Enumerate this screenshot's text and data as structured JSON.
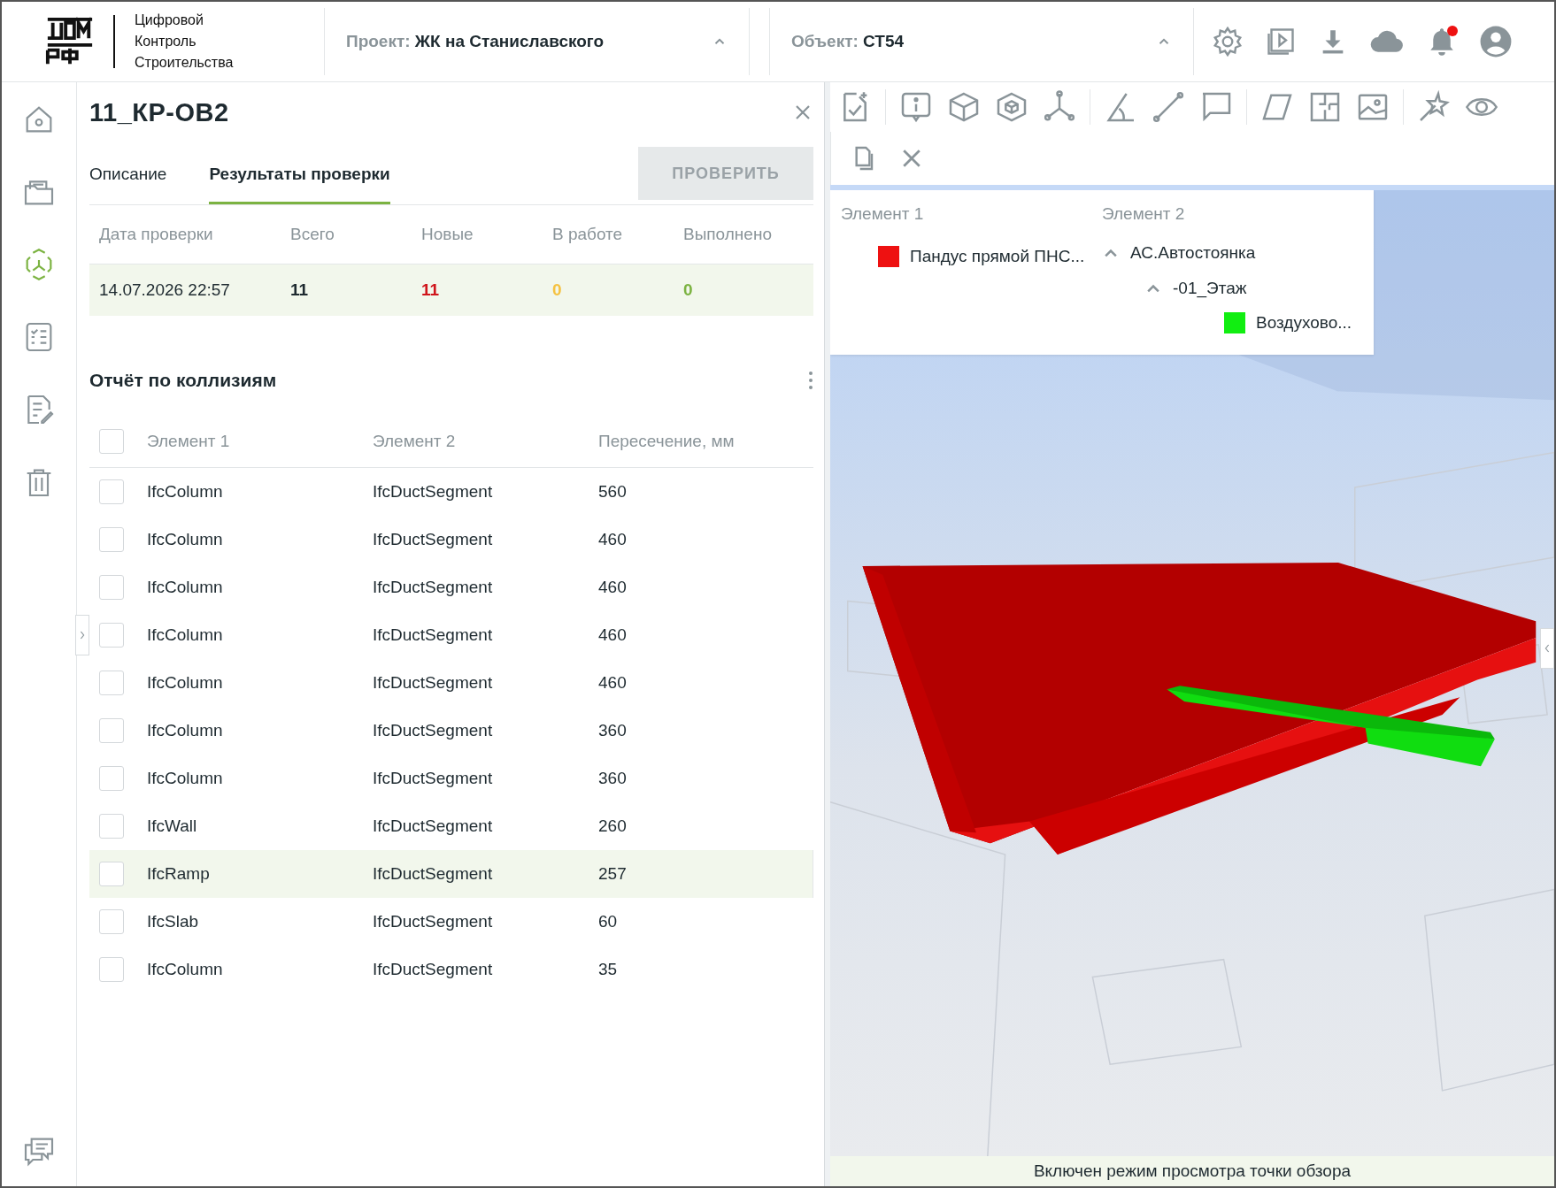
{
  "header": {
    "logo_lines": [
      "Цифровой",
      "Контроль",
      "Строительства"
    ],
    "project": {
      "label": "Проект:",
      "value": "ЖК на Станиславского",
      "expanded": true
    },
    "object": {
      "label": "Объект:",
      "value": "СТ54",
      "expanded": true
    },
    "notifications": {
      "unread": true
    }
  },
  "sidebar": {
    "items": [
      {
        "kind": "home",
        "selected": false
      },
      {
        "kind": "folder",
        "selected": false
      },
      {
        "kind": "model",
        "selected": true
      },
      {
        "kind": "checklist",
        "selected": false
      },
      {
        "kind": "document",
        "selected": false
      },
      {
        "kind": "trash",
        "selected": false
      }
    ]
  },
  "panel": {
    "title": "11_КР-ОВ2",
    "tabs": [
      {
        "label": "Описание",
        "selected": false
      },
      {
        "label": "Результаты проверки",
        "selected": true
      }
    ],
    "check_button": {
      "label": "ПРОВЕРИТЬ",
      "disabled": true
    },
    "summary": {
      "columns": [
        "Дата проверки",
        "Всего",
        "Новые",
        "В работе",
        "Выполнено"
      ],
      "cells": [
        {
          "text": "14.07.2026 22:57",
          "color": "#1e2a30"
        },
        {
          "text": "11",
          "color": "#1e2a30"
        },
        {
          "text": "11",
          "color": "#d0151b"
        },
        {
          "text": "0",
          "color": "#f5c242"
        },
        {
          "text": "0",
          "color": "#7cb342"
        }
      ]
    },
    "report": {
      "title": "Отчёт по коллизиям",
      "select_all": false,
      "columns": [
        "Элемент 1",
        "Элемент 2",
        "Пересечение, мм"
      ],
      "rows": [
        {
          "element_1": "IfcColumn",
          "element_2": "IfcDuctSegment",
          "intersection": "560",
          "checked": false,
          "selected": false
        },
        {
          "element_1": "IfcColumn",
          "element_2": "IfcDuctSegment",
          "intersection": "460",
          "checked": false,
          "selected": false
        },
        {
          "element_1": "IfcColumn",
          "element_2": "IfcDuctSegment",
          "intersection": "460",
          "checked": false,
          "selected": false
        },
        {
          "element_1": "IfcColumn",
          "element_2": "IfcDuctSegment",
          "intersection": "460",
          "checked": false,
          "selected": false
        },
        {
          "element_1": "IfcColumn",
          "element_2": "IfcDuctSegment",
          "intersection": "460",
          "checked": false,
          "selected": false
        },
        {
          "element_1": "IfcColumn",
          "element_2": "IfcDuctSegment",
          "intersection": "360",
          "checked": false,
          "selected": false
        },
        {
          "element_1": "IfcColumn",
          "element_2": "IfcDuctSegment",
          "intersection": "360",
          "checked": false,
          "selected": false
        },
        {
          "element_1": "IfcWall",
          "element_2": "IfcDuctSegment",
          "intersection": "260",
          "checked": false,
          "selected": false
        },
        {
          "element_1": "IfcRamp",
          "element_2": "IfcDuctSegment",
          "intersection": "257",
          "checked": false,
          "selected": true
        },
        {
          "element_1": "IfcSlab",
          "element_2": "IfcDuctSegment",
          "intersection": "60",
          "checked": false,
          "selected": false
        },
        {
          "element_1": "IfcColumn",
          "element_2": "IfcDuctSegment",
          "intersection": "35",
          "checked": false,
          "selected": false
        }
      ]
    }
  },
  "viewer": {
    "legend": {
      "element_1_heading": "Элемент 1",
      "element_2_heading": "Элемент 2",
      "element_1": [
        {
          "name": "Пандус прямой ПНС...",
          "color": "#ee1111"
        }
      ],
      "element_2": [
        {
          "name": "АС.Автостоянка",
          "expanded": true,
          "children": [
            {
              "name": "-01_Этаж",
              "expanded": true,
              "children": [
                {
                  "name": "Воздухово...",
                  "color": "#11ee11"
                }
              ]
            }
          ]
        }
      ]
    },
    "status": "Включен режим просмотра точки обзора"
  }
}
